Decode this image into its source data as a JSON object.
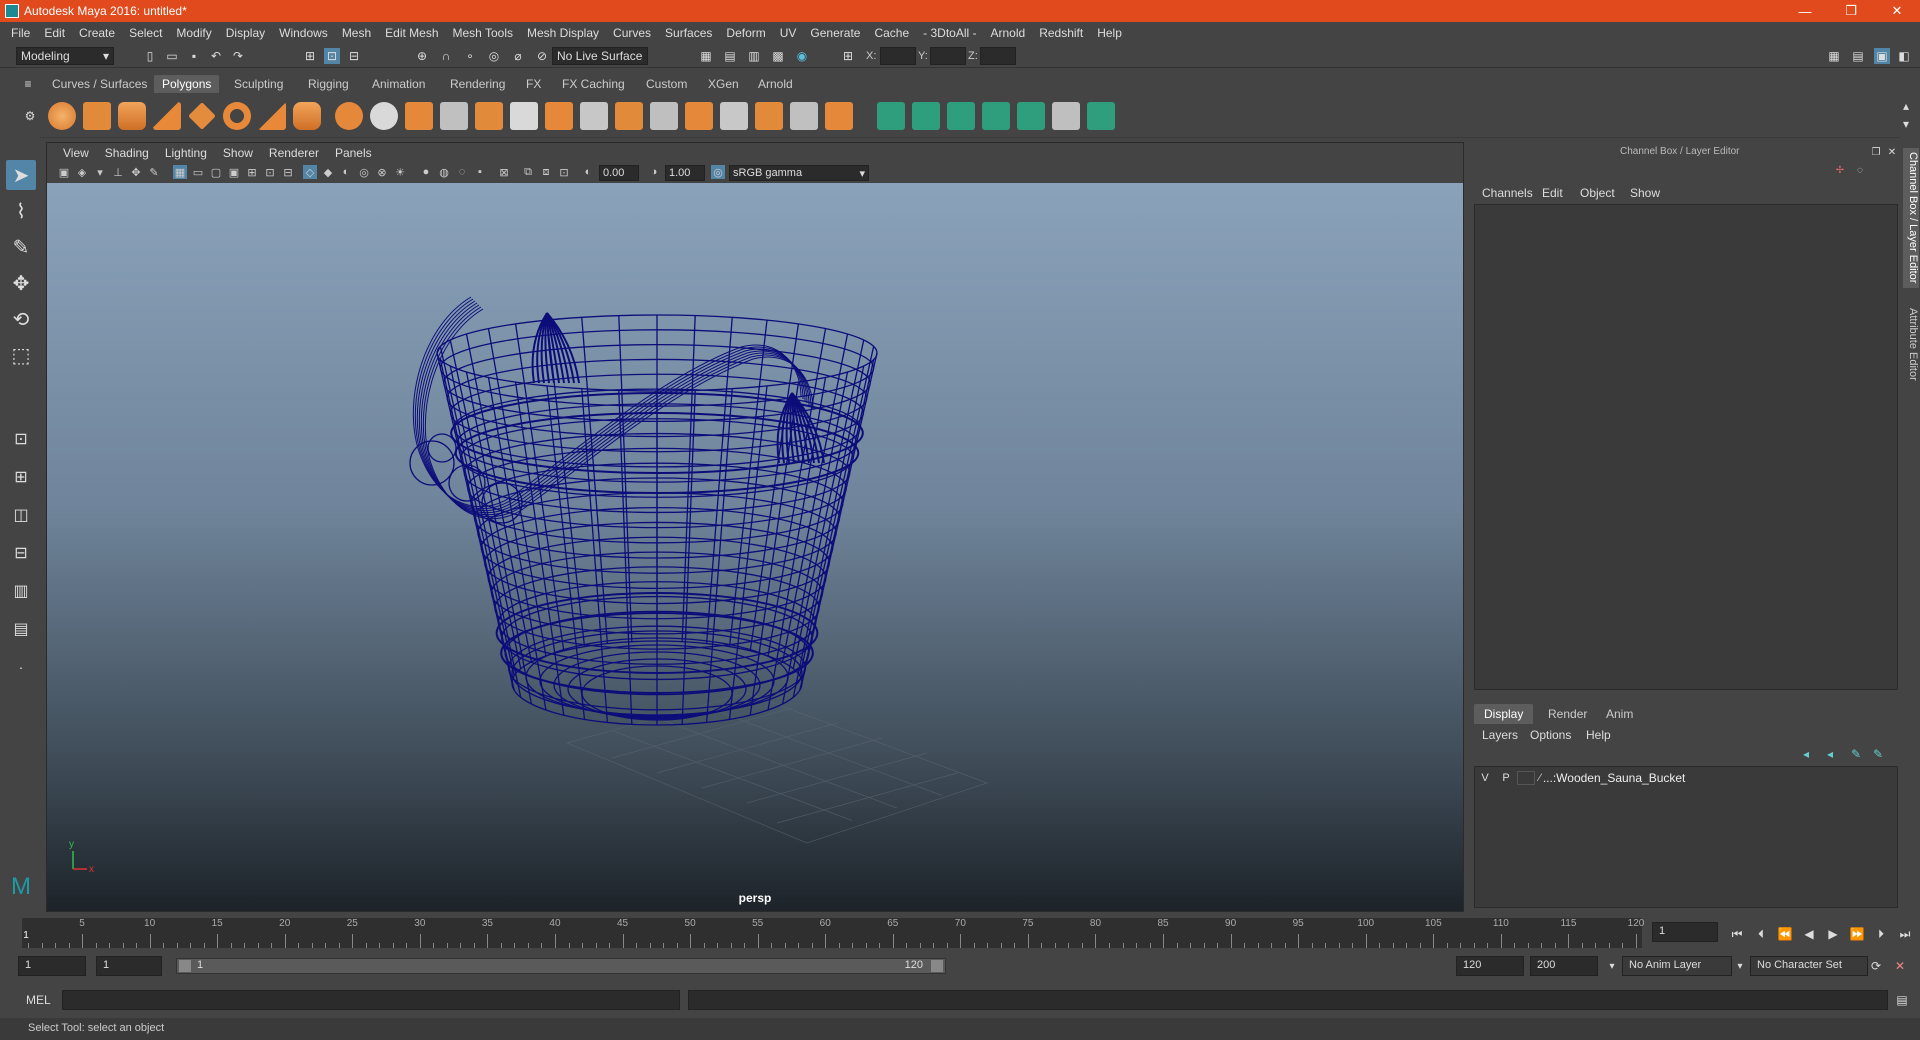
{
  "title": "Autodesk Maya 2016: untitled*",
  "window_buttons": [
    "—",
    "❐",
    "✕"
  ],
  "menus": [
    "File",
    "Edit",
    "Create",
    "Select",
    "Modify",
    "Display",
    "Windows",
    "Mesh",
    "Edit Mesh",
    "Mesh Tools",
    "Mesh Display",
    "Curves",
    "Surfaces",
    "Deform",
    "UV",
    "Generate",
    "Cache",
    "- 3DtoAll -",
    "Arnold",
    "Redshift",
    "Help"
  ],
  "statusline": {
    "mode": "Modeling",
    "live_surface": "No Live Surface",
    "x_label": "X:",
    "y_label": "Y:",
    "z_label": "Z:"
  },
  "shelf_tabs": [
    "Curves / Surfaces",
    "Polygons",
    "Sculpting",
    "Rigging",
    "Animation",
    "Rendering",
    "FX",
    "FX Caching",
    "Custom",
    "XGen",
    "Arnold"
  ],
  "shelf_active": "Polygons",
  "viewport": {
    "menus": [
      "View",
      "Shading",
      "Lighting",
      "Show",
      "Renderer",
      "Panels"
    ],
    "exposure": "0.00",
    "gamma": "1.00",
    "color_space": "sRGB gamma",
    "camera": "persp"
  },
  "channel_box": {
    "title": "Channel Box / Layer Editor",
    "menus": [
      "Channels",
      "Edit",
      "Object",
      "Show"
    ]
  },
  "layer_editor": {
    "tabs": [
      "Display",
      "Render",
      "Anim"
    ],
    "active_tab": "Display",
    "menus": [
      "Layers",
      "Options",
      "Help"
    ],
    "layer": {
      "v": "V",
      "p": "P",
      "name": "...:Wooden_Sauna_Bucket"
    }
  },
  "side_tabs": [
    "Channel Box / Layer Editor",
    "Attribute Editor"
  ],
  "timeline": {
    "ticks": [
      5,
      10,
      15,
      20,
      25,
      30,
      35,
      40,
      45,
      50,
      55,
      60,
      65,
      70,
      75,
      80,
      85,
      90,
      95,
      100,
      105,
      110,
      115,
      120
    ],
    "start": 1,
    "end": 120,
    "current_frame": "1"
  },
  "range": {
    "start": "1",
    "playback_start": "1",
    "slider_start": "1",
    "slider_end": "120",
    "playback_end": "120",
    "end": "200",
    "anim_layer": "No Anim Layer",
    "char_set": "No Character Set"
  },
  "cmdline": {
    "label": "MEL"
  },
  "help_line": "Select Tool: select an object",
  "colors": {
    "title_bar": "#e14a1c",
    "accent": "#5285a6",
    "wireframe": "#0d0d7a"
  }
}
